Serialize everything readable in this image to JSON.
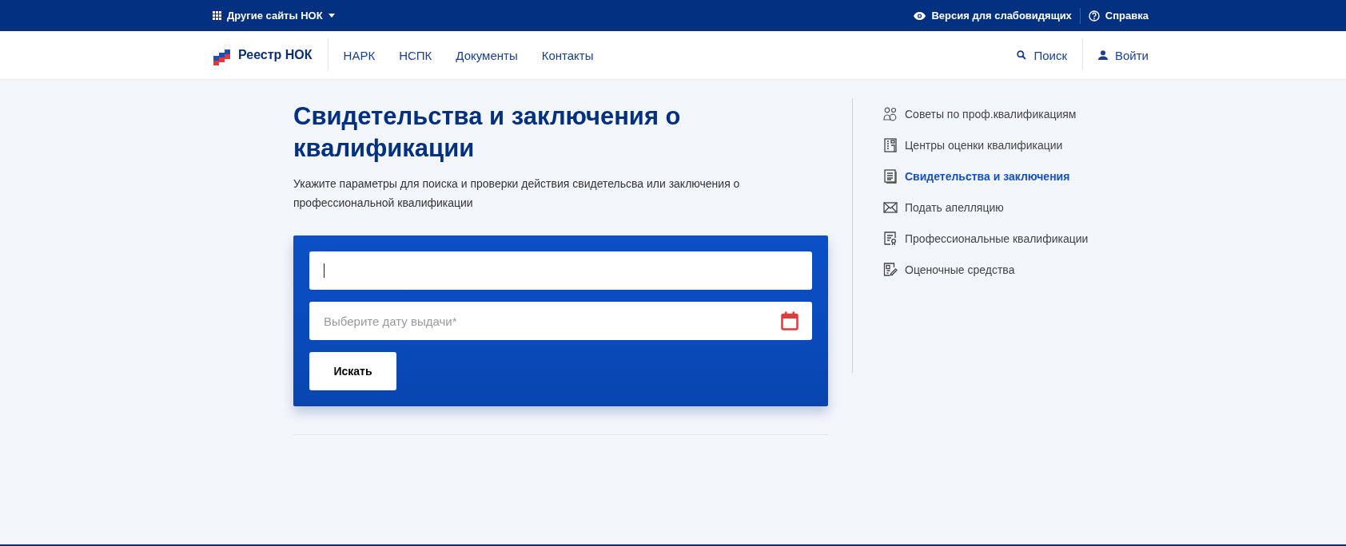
{
  "top_bar": {
    "sites_menu": "Другие сайты НОК",
    "links": [
      {
        "kind": "eye",
        "label": "Версия для слабовидящих"
      },
      {
        "kind": "help",
        "label": "Справка"
      }
    ]
  },
  "header": {
    "logo": "Реестр НОК",
    "nav": [
      {
        "label": "НАРК"
      },
      {
        "label": "НСПК"
      },
      {
        "label": "Документы"
      },
      {
        "label": "Контакты"
      }
    ],
    "search": "Поиск",
    "login": "Войти"
  },
  "page": {
    "title": "Свидетельства и заключения о квалификации",
    "description": "Укажите параметры для поиска и проверки действия свидетельсва или заключения о профессиональной квалификации"
  },
  "form": {
    "date_field": {
      "placeholder": "Выберите дату выдачи*"
    },
    "submit": "Искать"
  },
  "sidebar": {
    "items": [
      {
        "kind": "people",
        "label": "Советы по проф.квалификациям",
        "selected": false
      },
      {
        "kind": "building",
        "label": "Центры оценки квалификации",
        "selected": false
      },
      {
        "kind": "document",
        "label": "Свидетельства и заключения",
        "selected": true
      },
      {
        "kind": "envelope",
        "label": "Подать апелляцию",
        "selected": false
      },
      {
        "kind": "certificate",
        "label": "Профессиональные квалификации",
        "selected": false
      },
      {
        "kind": "edit",
        "label": "Оценочные средства",
        "selected": false
      }
    ]
  }
}
